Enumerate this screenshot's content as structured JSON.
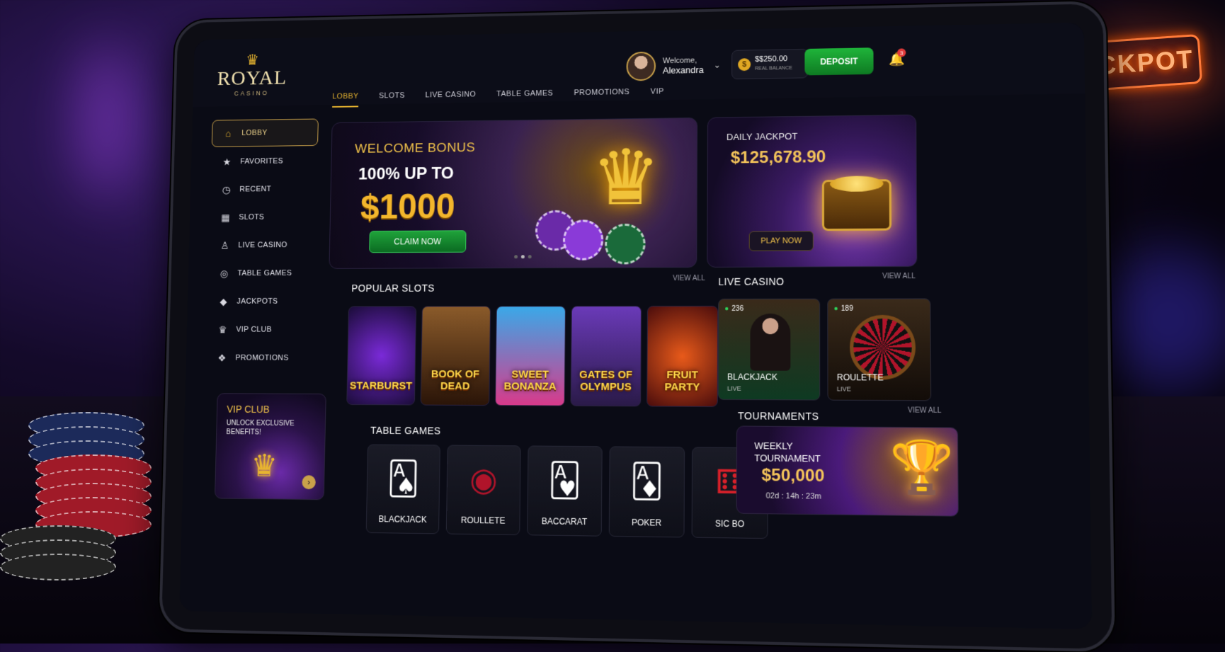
{
  "background": {
    "neon_sign": "JACKPOT"
  },
  "brand": {
    "name": "ROYAL",
    "sub": "CASINO"
  },
  "user": {
    "greeting": "Welcome,",
    "name": "Alexandra"
  },
  "balance": {
    "amount": "$$250.00",
    "label": "REAL BALANCE"
  },
  "deposit_label": "DEPOSIT",
  "notifications_count": "3",
  "tabs": [
    "LOBBY",
    "SLOTS",
    "LIVE CASINO",
    "TABLE GAMES",
    "PROMOTIONS",
    "VIP"
  ],
  "sidebar": [
    {
      "label": "LOBBY",
      "icon": "home-icon"
    },
    {
      "label": "FAVORITES",
      "icon": "star-icon"
    },
    {
      "label": "RECENT",
      "icon": "clock-icon"
    },
    {
      "label": "SLOTS",
      "icon": "slot-machine-icon"
    },
    {
      "label": "LIVE CASINO",
      "icon": "dealer-icon"
    },
    {
      "label": "TABLE GAMES",
      "icon": "table-icon"
    },
    {
      "label": "JACKPOTS",
      "icon": "diamond-icon"
    },
    {
      "label": "VIP CLUB",
      "icon": "crown-icon"
    },
    {
      "label": "PROMOTIONS",
      "icon": "gift-icon"
    }
  ],
  "vip_card": {
    "title": "VIP CLUB",
    "subtitle": "UNLOCK EXCLUSIVE BENEFITS!"
  },
  "hero": {
    "kicker": "WELCOME BONUS",
    "line": "100% UP TO",
    "amount": "$1000",
    "cta": "CLAIM NOW"
  },
  "jackpot": {
    "label": "DAILY JACKPOT",
    "amount": "$125,678.90",
    "cta": "PLAY NOW"
  },
  "sections": {
    "popular_slots": "POPULAR SLOTS",
    "live_casino": "LIVE CASINO",
    "table_games": "TABLE GAMES",
    "tournaments": "TOURNAMENTS",
    "view_all": "VIEW ALL"
  },
  "slots": [
    "STARBURST",
    "BOOK OF DEAD",
    "SWEET BONANZA",
    "GATES OF OLYMPUS",
    "FRUIT PARTY"
  ],
  "live_games": [
    {
      "name": "BLACKJACK",
      "tag": "LIVE",
      "players": "236"
    },
    {
      "name": "ROULETTE",
      "tag": "LIVE",
      "players": "189"
    }
  ],
  "table_games": [
    "BLACKJACK",
    "ROULLETE",
    "BACCARAT",
    "POKER",
    "SIC BO"
  ],
  "tournament": {
    "title": "WEEKLY TOURNAMENT",
    "prize": "$50,000",
    "timer": "02d : 14h : 23m"
  },
  "colors": {
    "accent_gold": "#e8b530",
    "cta_green": "#1fa23a",
    "bg_dark": "#0a0b15"
  }
}
